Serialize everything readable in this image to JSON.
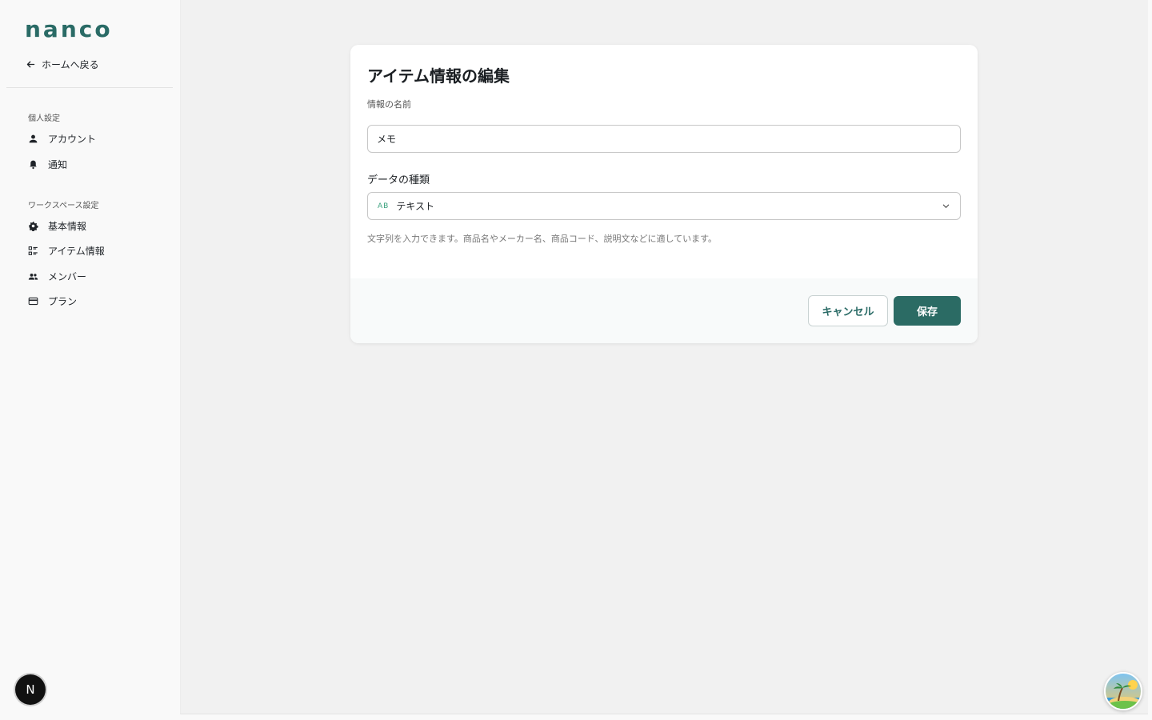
{
  "sidebar": {
    "logo": "nanco",
    "back_label": "ホームへ戻る",
    "personal_title": "個人設定",
    "personal_items": [
      {
        "label": "アカウント",
        "icon": "person-icon"
      },
      {
        "label": "通知",
        "icon": "bell-icon"
      }
    ],
    "workspace_title": "ワークスペース設定",
    "workspace_items": [
      {
        "label": "基本情報",
        "icon": "gear-icon"
      },
      {
        "label": "アイテム情報",
        "icon": "list-icon"
      },
      {
        "label": "メンバー",
        "icon": "group-icon"
      },
      {
        "label": "プラン",
        "icon": "credit-card-icon"
      }
    ],
    "user_initial": "N"
  },
  "dialog": {
    "title": "アイテム情報の編集",
    "name_label": "情報の名前",
    "name_value": "メモ",
    "type_label": "データの種類",
    "type_icon_text": "AB",
    "type_value": "テキスト",
    "help_text": "文字列を入力できます。商品名やメーカー名、商品コード、説明文などに適しています。",
    "cancel_label": "キャンセル",
    "save_label": "保存"
  },
  "colors": {
    "brand": "#2a6b66",
    "save_button": "#2b6b64",
    "type_icon": "#3aa17e"
  }
}
